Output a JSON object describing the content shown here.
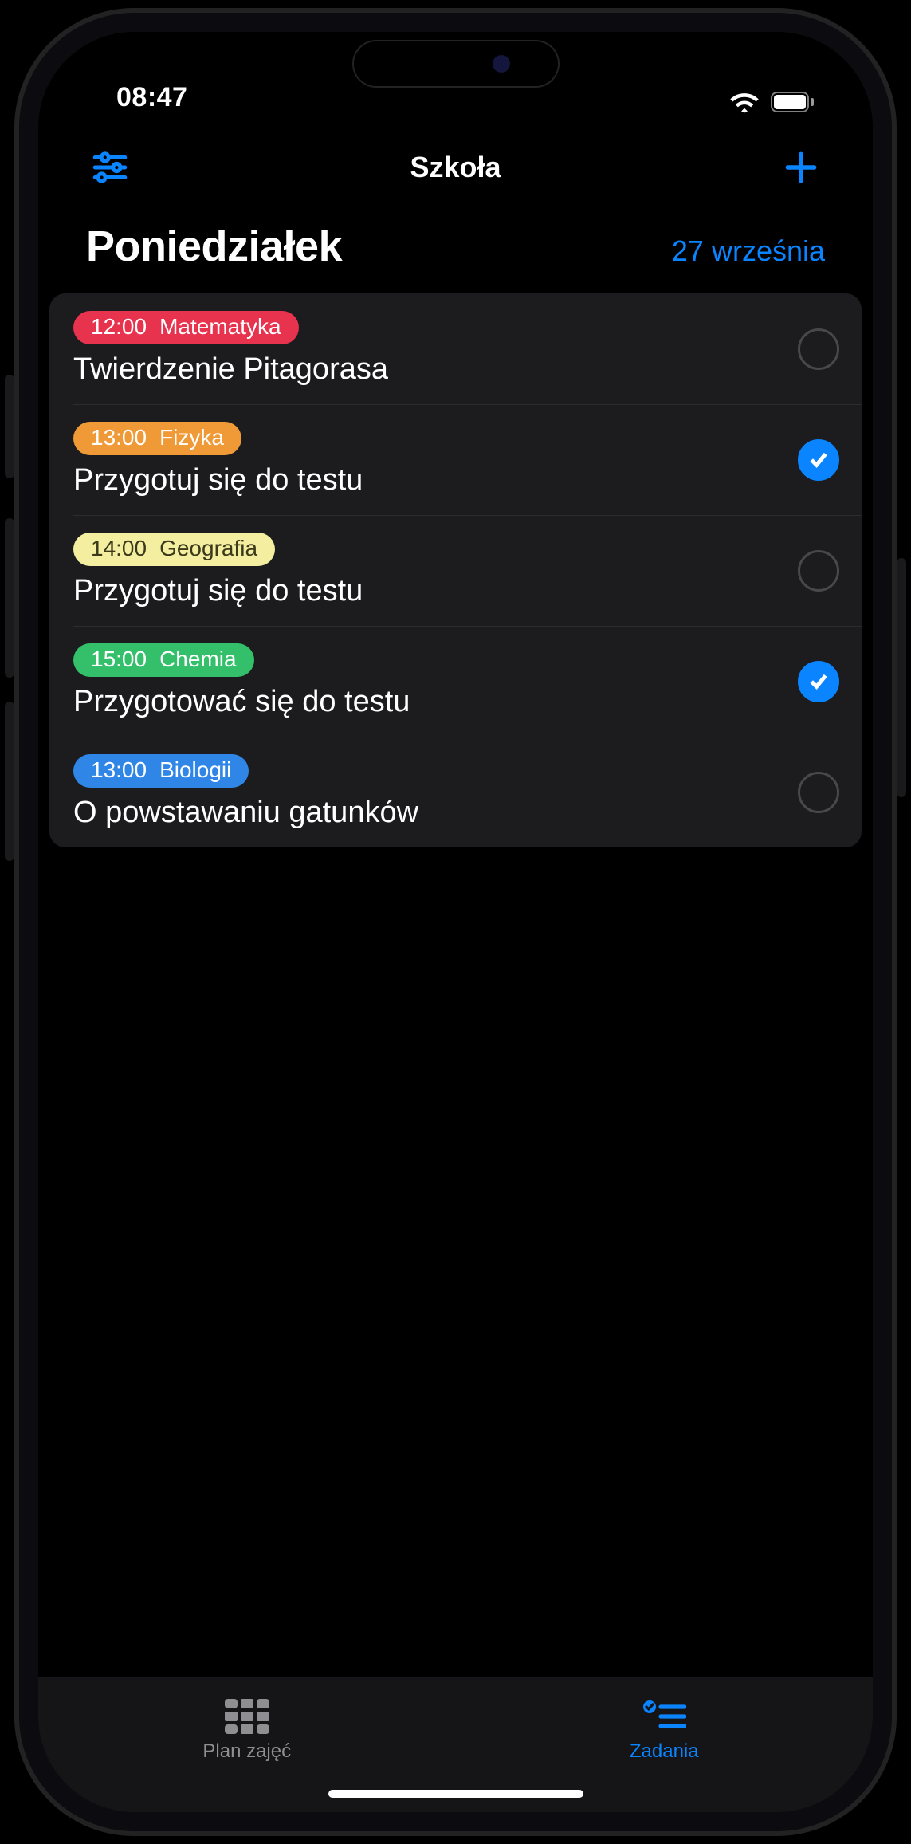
{
  "status": {
    "time": "08:47"
  },
  "nav": {
    "title": "Szkoła"
  },
  "header": {
    "day": "Poniedziałek",
    "date": "27 września"
  },
  "tasks": [
    {
      "time": "12:00",
      "subject": "Matematyka",
      "title": "Twierdzenie Pitagorasa",
      "done": false,
      "bg": "#e8334f",
      "fg": "#ffffff"
    },
    {
      "time": "13:00",
      "subject": "Fizyka",
      "title": "Przygotuj się do testu",
      "done": true,
      "bg": "#f09a37",
      "fg": "#ffffff"
    },
    {
      "time": "14:00",
      "subject": "Geografia",
      "title": "Przygotuj się do testu",
      "done": false,
      "bg": "#f4eea0",
      "fg": "#3a3a1a"
    },
    {
      "time": "15:00",
      "subject": "Chemia",
      "title": "Przygotować się do testu",
      "done": true,
      "bg": "#34c06b",
      "fg": "#ffffff"
    },
    {
      "time": "13:00",
      "subject": "Biologii",
      "title": "O powstawaniu gatunków",
      "done": false,
      "bg": "#2f86e6",
      "fg": "#ffffff"
    }
  ],
  "tabs": {
    "schedule": "Plan zajęć",
    "tasks": "Zadania",
    "active": "tasks"
  }
}
